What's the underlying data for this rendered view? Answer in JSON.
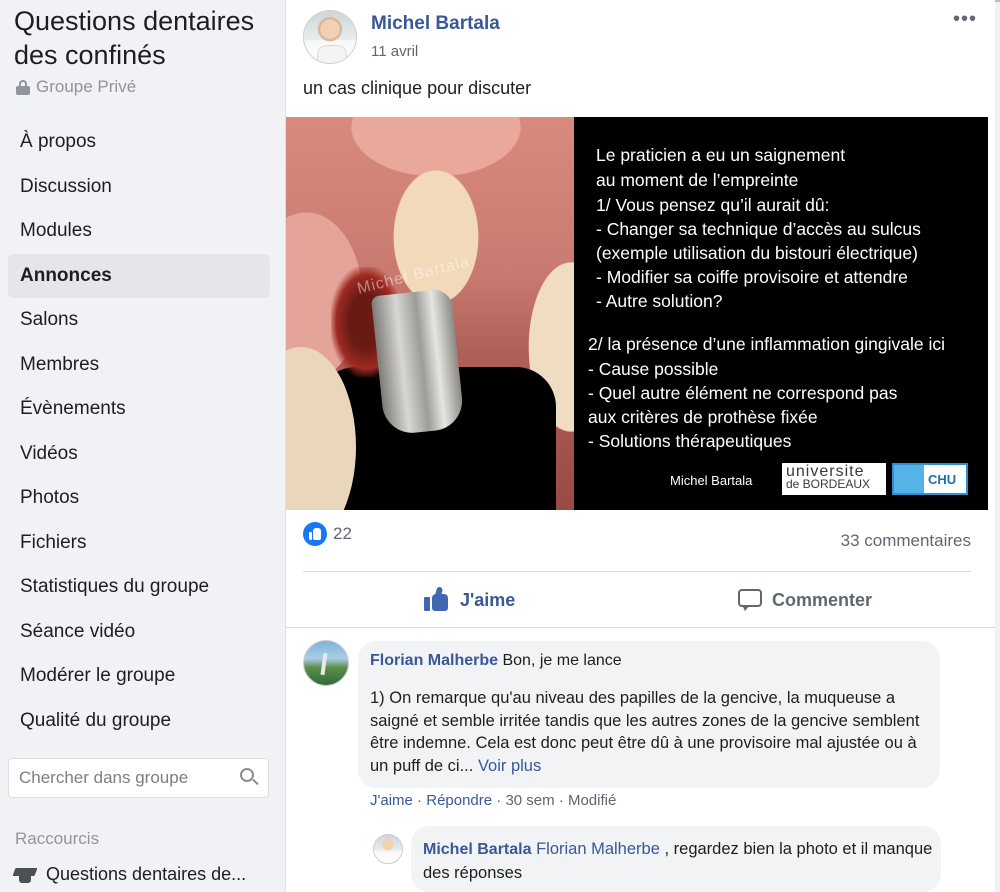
{
  "sidebar": {
    "group_title": "Questions dentaires des confinés",
    "privacy_label": "Groupe Privé",
    "nav": [
      {
        "label": "À propos"
      },
      {
        "label": "Discussion"
      },
      {
        "label": "Modules"
      },
      {
        "label": "Annonces"
      },
      {
        "label": "Salons"
      },
      {
        "label": "Membres"
      },
      {
        "label": "Évènements"
      },
      {
        "label": "Vidéos"
      },
      {
        "label": "Photos"
      },
      {
        "label": "Fichiers"
      },
      {
        "label": "Statistiques du groupe"
      },
      {
        "label": "Séance vidéo"
      },
      {
        "label": "Modérer le groupe"
      },
      {
        "label": "Qualité du groupe"
      }
    ],
    "active_index": 3,
    "search_placeholder": "Chercher dans groupe",
    "shortcuts_title": "Raccourcis",
    "shortcut_item": "Questions dentaires de..."
  },
  "post": {
    "author": "Michel Bartala",
    "date": "11 avril",
    "more_label": "•••",
    "text": "un cas clinique pour discuter",
    "image": {
      "watermark": "Michel Bartala",
      "lines": [
        "Le praticien a eu un saignement",
        " au moment de l’empreinte",
        " 1/ Vous pensez qu’il aurait dû:",
        " -     Changer sa technique d’accès au sulcus",
        " (exemple utilisation du bistouri électrique)",
        " -     Modifier sa coiffe provisoire et attendre",
        " -     Autre solution?",
        "2/ la présence d’une inflammation gingivale ici",
        "- Cause possible",
        "- Quel autre élément ne correspond pas",
        "aux critères de prothèse fixée",
        "- Solutions thérapeutiques"
      ],
      "author_caption": "Michel Bartala",
      "logo_ub_line1": "universite",
      "logo_ub_line2": "de BORDEAUX",
      "logo_chu": "CHU"
    },
    "likes_count": "22",
    "comments_count": "33 commentaires",
    "like_label": "J'aime",
    "comment_label": "Commenter"
  },
  "comment": {
    "author": "Florian Malherbe",
    "head_text": " Bon, je me lance",
    "body": "1) On remarque qu'au niveau des papilles de la gencive, la muqueuse a saigné et semble irritée tandis que les autres zones de la gencive semblent être indemne. Cela est donc peut être dû à une provisoire mal ajustée ou à un puff de ci...",
    "see_more": "Voir plus",
    "meta_like": "J'aime",
    "meta_sep1": " · ",
    "meta_reply": "Répondre",
    "meta_rest": " · 30 sem · Modifié"
  },
  "reply": {
    "author": "Michel Bartala",
    "mention": "Florian Malherbe",
    "text": " , regardez bien la photo et il manque des réponses"
  }
}
